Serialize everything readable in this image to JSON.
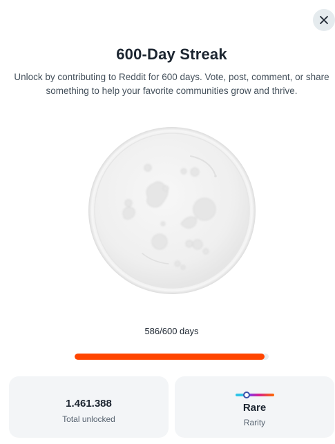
{
  "modal": {
    "title": "600-Day Streak",
    "description": "Unlock by contributing to Reddit for 600 days. Vote, post, comment, or share something to help your favorite communities grow and thrive.",
    "badge_icon": "locked-streak-badge",
    "close_icon": "close-icon"
  },
  "progress": {
    "text": "586/600 days",
    "current": 586,
    "goal": 600,
    "fraction": 0.977,
    "color": "#ff4500"
  },
  "stats": {
    "total_unlocked": {
      "value": "1.461.388",
      "label": "Total unlocked"
    },
    "rarity": {
      "value": "Rare",
      "label": "Rarity"
    }
  }
}
